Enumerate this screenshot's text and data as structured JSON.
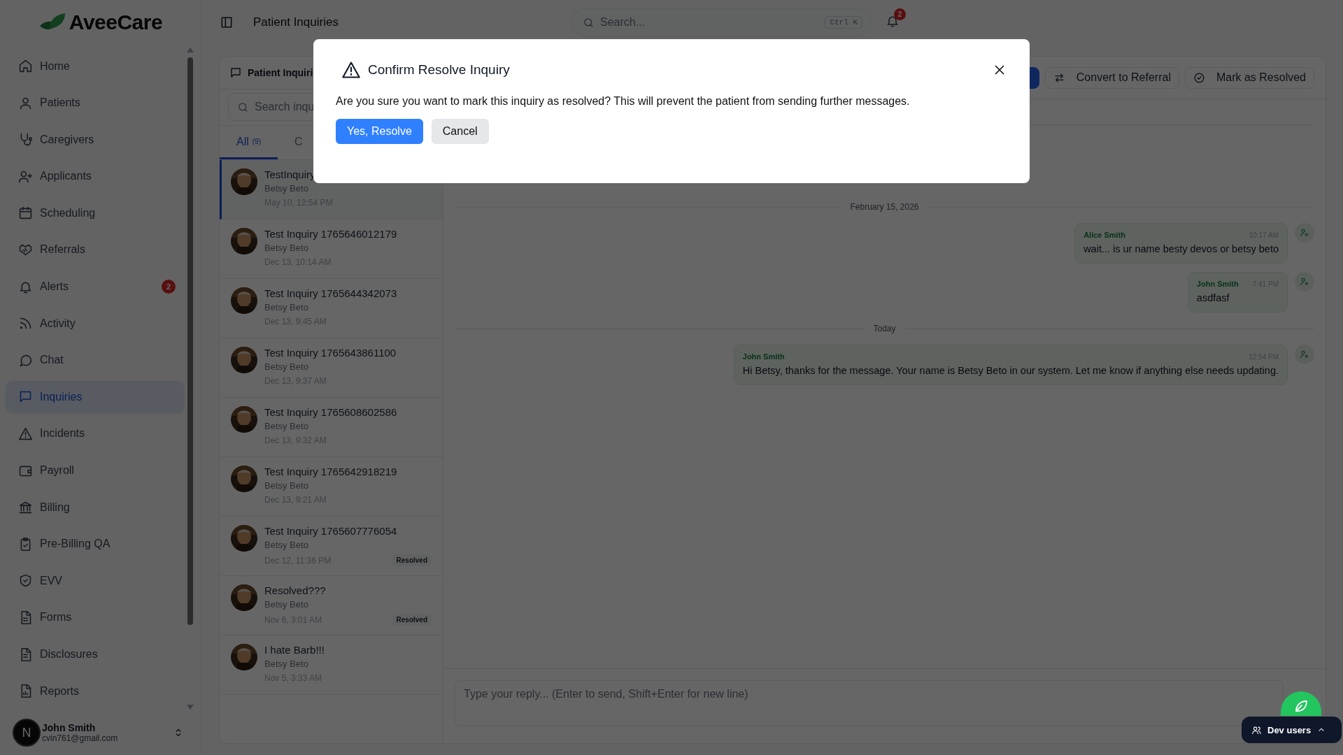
{
  "brand": {
    "name": "AveeCare"
  },
  "sidebar": {
    "items": [
      {
        "label": "Home",
        "selected": false
      },
      {
        "label": "Patients",
        "selected": false
      },
      {
        "label": "Caregivers",
        "selected": false
      },
      {
        "label": "Applicants",
        "selected": false
      },
      {
        "label": "Scheduling",
        "selected": false
      },
      {
        "label": "Referrals",
        "selected": false
      },
      {
        "label": "Alerts",
        "selected": false,
        "badge": "2"
      },
      {
        "label": "Activity",
        "selected": false
      },
      {
        "label": "Chat",
        "selected": false
      },
      {
        "label": "Inquiries",
        "selected": true
      },
      {
        "label": "Incidents",
        "selected": false
      },
      {
        "label": "Payroll",
        "selected": false
      },
      {
        "label": "Billing",
        "selected": false
      },
      {
        "label": "Pre-Billing QA",
        "selected": false
      },
      {
        "label": "EVV",
        "selected": false
      },
      {
        "label": "Forms",
        "selected": false
      },
      {
        "label": "Disclosures",
        "selected": false
      },
      {
        "label": "Reports",
        "selected": false
      }
    ],
    "user": {
      "initial": "N",
      "name": "John Smith",
      "email": "cvin761@gmail.com"
    }
  },
  "topbar": {
    "title": "Patient Inquiries",
    "search": {
      "placeholder": "Search...",
      "shortcut": "Ctrl K"
    },
    "notifications": "2"
  },
  "inquiries": {
    "title": "Patient Inquiri",
    "search": {
      "placeholder": "Search inqu"
    },
    "tabs": [
      {
        "label": "All",
        "count": "(9)",
        "selected": true
      },
      {
        "label": "C",
        "selected": false
      }
    ],
    "items": [
      {
        "title": "TestInquiry",
        "patient": "Betsy Beto",
        "time": "May 10, 12:54 PM",
        "selected": true
      },
      {
        "title": "Test Inquiry 1765646012179",
        "patient": "Betsy Beto",
        "time": "Dec 13, 10:14 AM",
        "selected": false
      },
      {
        "title": "Test Inquiry 1765644342073",
        "patient": "Betsy Beto",
        "time": "Dec 13, 9:45 AM",
        "selected": false
      },
      {
        "title": "Test Inquiry 1765643861100",
        "patient": "Betsy Beto",
        "time": "Dec 13, 9:37 AM",
        "selected": false
      },
      {
        "title": "Test Inquiry 1765608602586",
        "patient": "Betsy Beto",
        "time": "Dec 13, 9:32 AM",
        "selected": false
      },
      {
        "title": "Test Inquiry 1765642918219",
        "patient": "Betsy Beto",
        "time": "Dec 13, 9:21 AM",
        "selected": false
      },
      {
        "title": "Test Inquiry 1765607776054",
        "patient": "Betsy Beto",
        "time": "Dec 12, 11:36 PM",
        "status": "Resolved",
        "selected": false
      },
      {
        "title": "Resolved???",
        "patient": "Betsy Beto",
        "time": "Nov 6, 3:01 AM",
        "status": "Resolved",
        "selected": false
      },
      {
        "title": "I hate Barb!!!",
        "patient": "Betsy Beto",
        "time": "Nov 5, 3:33 AM",
        "selected": false
      }
    ]
  },
  "conversation": {
    "actions": [
      {
        "kind": "primary"
      },
      {
        "kind": "outline",
        "label": "Convert to Referral"
      },
      {
        "kind": "outline",
        "label": "Mark as Resolved"
      }
    ],
    "messages": [
      {
        "kind": "separator",
        "label": "February 15, 2026"
      },
      {
        "kind": "message",
        "sender": "Alice Smith",
        "time": "10:17 AM",
        "text": "wait... is ur name besty devos or betsy beto"
      },
      {
        "kind": "message",
        "sender": "John Smith",
        "time": "7:41 PM",
        "text": "asdfasf"
      },
      {
        "kind": "separator",
        "label": "Today"
      },
      {
        "kind": "message",
        "sender": "John Smith",
        "time": "12:54 PM",
        "text": "Hi Betsy, thanks for the message. Your name is Betsy Beto in our system. Let me know if anything else needs updating."
      }
    ],
    "reply": {
      "placeholder": "Type your reply... (Enter to send, Shift+Enter for new line)"
    }
  },
  "dialog": {
    "title": "Confirm Resolve Inquiry",
    "text": "Are you sure you want to mark this inquiry as resolved? This will prevent the patient from sending further messages.",
    "confirm": "Yes, Resolve",
    "cancel": "Cancel"
  },
  "dev_users": {
    "label": "Dev users"
  }
}
